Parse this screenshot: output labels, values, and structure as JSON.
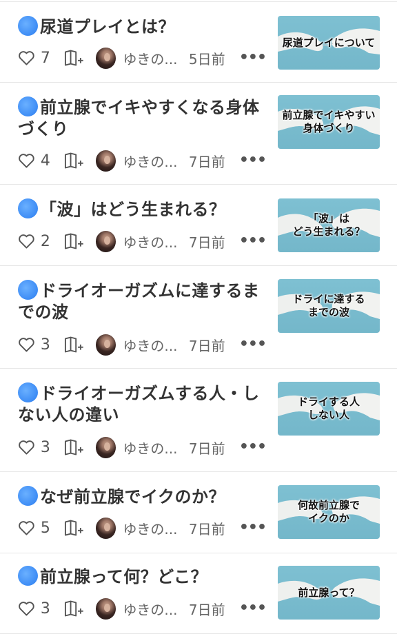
{
  "articles": [
    {
      "title": "尿道プレイとは？",
      "likes": "7",
      "author": "ゆきの...",
      "date": "5日前",
      "more": "•••",
      "thumb_text": "尿道プレイについて"
    },
    {
      "title": "前立腺でイキやすくなる身体づくり",
      "likes": "4",
      "author": "ゆきの...",
      "date": "7日前",
      "more": "•••",
      "thumb_text": "前立腺でイキやすい\n身体づくり"
    },
    {
      "title": "「波」はどう生まれる？",
      "likes": "2",
      "author": "ゆきの...",
      "date": "7日前",
      "more": "•••",
      "thumb_text": "「波」は\nどう生まれる？"
    },
    {
      "title": "ドライオーガズムに達するまでの波",
      "likes": "3",
      "author": "ゆきの...",
      "date": "7日前",
      "more": "•••",
      "thumb_text": "ドライに達する\nまでの波"
    },
    {
      "title": "ドライオーガズムする人・しない人の違い",
      "likes": "3",
      "author": "ゆきの...",
      "date": "7日前",
      "more": "•••",
      "thumb_text": "ドライする人\nしない人"
    },
    {
      "title": "なぜ前立腺でイクのか？",
      "likes": "5",
      "author": "ゆきの...",
      "date": "7日前",
      "more": "•••",
      "thumb_text": "何故前立腺で\nイクのか"
    },
    {
      "title": "前立腺って何？どこ？",
      "likes": "3",
      "author": "ゆきの...",
      "date": "7日前",
      "more": "•••",
      "thumb_text": "前立腺って？"
    }
  ],
  "icons": {
    "title_badge": "blue-circle-icon",
    "like": "heart-icon",
    "magazine": "magazine-add-icon",
    "menu": "more-icon"
  },
  "colors": {
    "accent_blue": "#3d8cf5",
    "thumb_bg": "#7ec0d2",
    "text": "#333333",
    "meta_text": "#666666"
  }
}
